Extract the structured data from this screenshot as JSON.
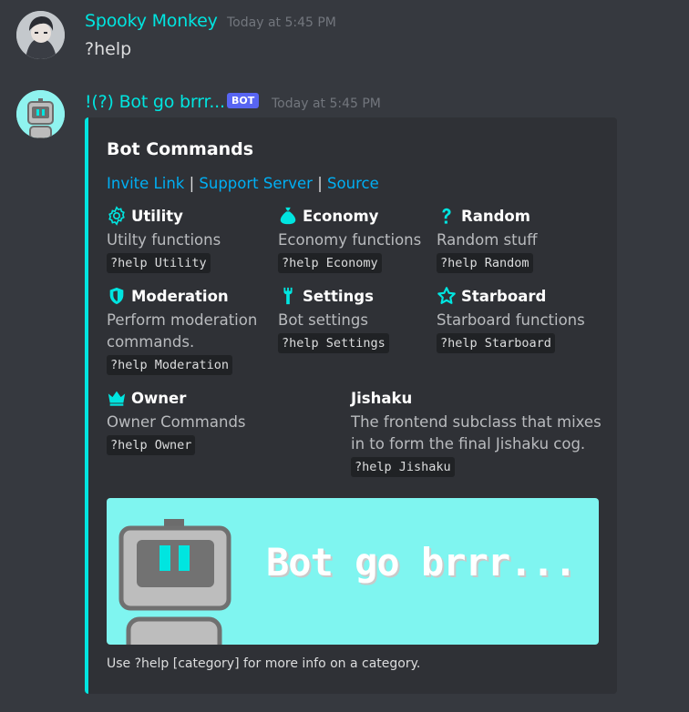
{
  "messages": [
    {
      "username": "Spooky Monkey",
      "timestamp": "Today at 5:45 PM",
      "content": "?help"
    },
    {
      "username": "!(?) Bot go brrr...",
      "badge": "BOT",
      "timestamp": "Today at 5:45 PM"
    }
  ],
  "embed": {
    "accent_color": "#00e5e0",
    "title": "Bot Commands",
    "links": {
      "invite": "Invite Link",
      "sep1": "|",
      "support": "Support Server",
      "sep2": "|",
      "source": "Source"
    },
    "fields": {
      "utility": {
        "icon": "gear-icon",
        "name": "Utility",
        "value": "Utilty functions",
        "cmd": "?help Utility"
      },
      "economy": {
        "icon": "money-bag-icon",
        "name": "Economy",
        "value": "Economy functions",
        "cmd": "?help Economy"
      },
      "random": {
        "icon": "question-icon",
        "name": "Random",
        "value": "Random stuff",
        "cmd": "?help Random"
      },
      "moderation": {
        "icon": "shield-icon",
        "name": "Moderation",
        "value_line1": "Perform moderation",
        "value_line2": "commands.",
        "cmd": "?help Moderation"
      },
      "settings": {
        "icon": "wrench-icon",
        "name": "Settings",
        "value": "Bot settings",
        "cmd": "?help Settings"
      },
      "starboard": {
        "icon": "star-icon",
        "name": "Starboard",
        "value": "Starboard functions",
        "cmd": "?help Starboard"
      },
      "owner": {
        "icon": "crown-icon",
        "name": "Owner",
        "value": "Owner Commands",
        "cmd": "?help Owner"
      },
      "jishaku": {
        "name": "Jishaku",
        "value_line1": "The frontend subclass that mixes",
        "value_line2": "in to form the final Jishaku cog.",
        "cmd": "?help Jishaku"
      }
    },
    "banner": {
      "text": "Bot go brrr..."
    },
    "footer": "Use ?help [category] for more info on a category."
  }
}
